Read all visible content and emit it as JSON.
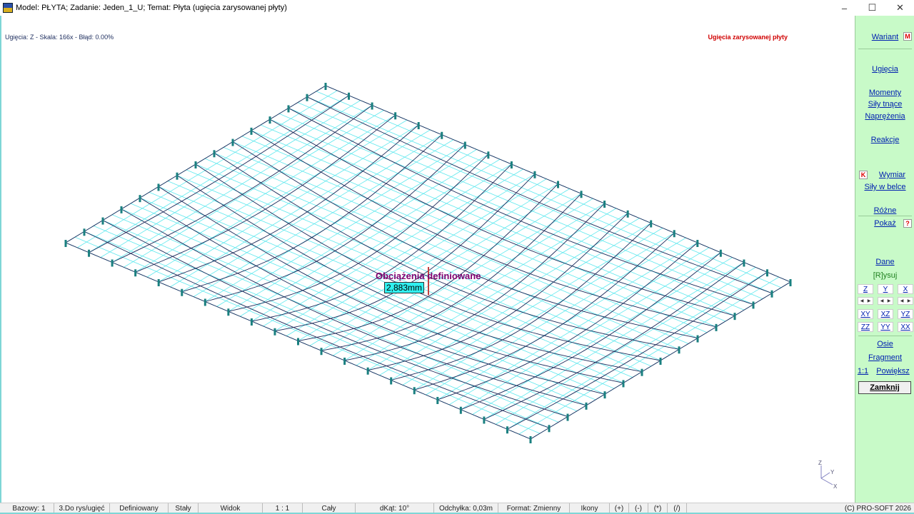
{
  "window": {
    "title": "Model: PŁYTA;  Zadanie: Jeden_1_U;  Temat: Płyta (ugięcia zarysowanej płyty)",
    "minimize": "–",
    "maximize": "☐",
    "close": "✕"
  },
  "view": {
    "info_left": "Ugięcia: Z  -  Skala: 166x  -  Błąd: 0.00%",
    "info_right": "Ugięcia zarysowanej płyty",
    "load_label": "Obciążenia definiowane",
    "max_value": "2,883mm",
    "axis": {
      "z": "Z",
      "y": "Y",
      "x": "X"
    },
    "colors": {
      "deformed": "#1a2a5a",
      "undeformed": "#5ee8ee",
      "supports": "#1a8080",
      "marker": "#c04040"
    }
  },
  "panel": {
    "wariant": "Wariant",
    "wariant_badge": "M",
    "ugiecia": "Ugięcia",
    "momenty": "Momenty",
    "sily_tnace": "Siły tnące",
    "naprezenia": "Naprężenia",
    "reakcje": "Reakcje",
    "wymiar_badge": "K",
    "wymiar": "Wymiar",
    "sily_w_belce": "Siły w belce",
    "rozne": "Różne",
    "pokaz": "Pokaż",
    "pokaz_badge": "?",
    "dane": "Dane",
    "rysuj": "[R]ysuj",
    "views": [
      "Z",
      "Y",
      "X",
      "XY",
      "XZ",
      "YZ",
      "ZZ",
      "YY",
      "XX"
    ],
    "osie": "Osie",
    "fragment": "Fragment",
    "one_to_one": "1:1",
    "powieksz": "Powiększ",
    "zamknij": "Zamknij"
  },
  "status": [
    "Bazowy: 1",
    "3.Do rys/ugięć",
    "Definiowany",
    "Stały",
    "Widok",
    "1 : 1",
    "Cały",
    "dKąt: 10°",
    "Odchyłka: 0,03m",
    "Format: Zmienny",
    "Ikony",
    "(+)",
    "(-)",
    "(*)",
    "(/)",
    "(C) PRO-SOFT 2026"
  ]
}
